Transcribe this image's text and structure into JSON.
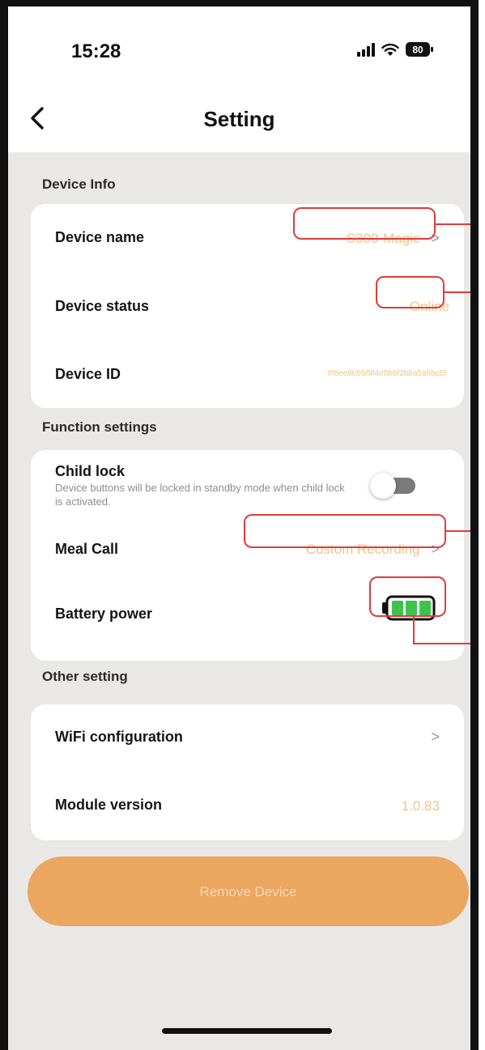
{
  "status_bar": {
    "time": "15:28",
    "battery_level": "80"
  },
  "nav": {
    "title": "Setting",
    "back_icon": "chevron-left-icon"
  },
  "device_info": {
    "title": "Device Info",
    "rows": [
      {
        "label": "Device name",
        "value": "S300-Magic"
      },
      {
        "label": "Device status",
        "value": "Online"
      },
      {
        "label": "Device ID",
        "value": "6f6ee8b55f9f4e8bbf2bba5a6bc5f"
      }
    ]
  },
  "function_settings": {
    "title": "Function settings",
    "child_lock": {
      "label": "Child lock",
      "description": "Device buttons will be locked in standby mode when child lock is activated.",
      "enabled": false
    },
    "meal_call": {
      "label": "Meal Call",
      "value": "Custom Recording"
    },
    "battery": {
      "label": "Battery power",
      "level": 1.0
    }
  },
  "other_setting": {
    "title": "Other setting",
    "rows": [
      {
        "label": "WiFi configuration",
        "value": ""
      },
      {
        "label": "Module version",
        "value": "1.0.83"
      }
    ]
  },
  "remove_button": {
    "label": "Remove Device"
  },
  "colors": {
    "accent": "#eba65f",
    "value_text": "#f0c58a",
    "annotation": "#e23b3b",
    "background": "#e9e8e7"
  }
}
